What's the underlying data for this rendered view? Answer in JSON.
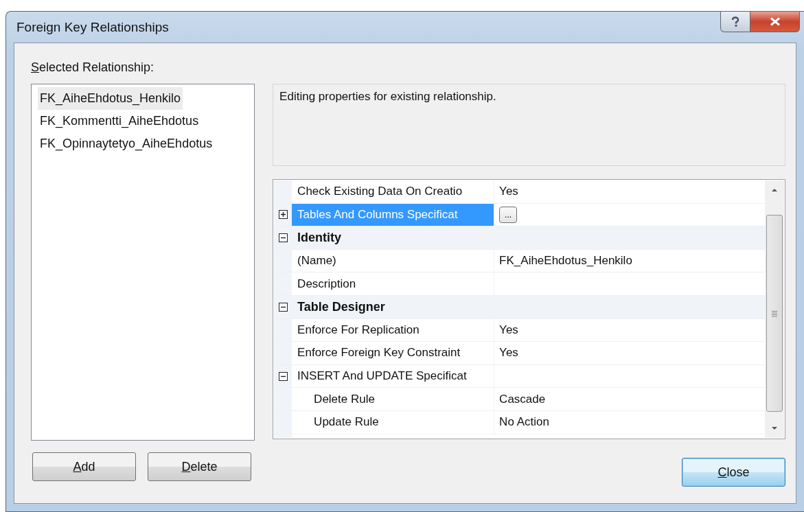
{
  "window": {
    "title": "Foreign Key Relationships"
  },
  "relationships_label": {
    "text": "Selected Relationship:",
    "underline_first": true
  },
  "relationships": [
    {
      "label": "FK_AiheEhdotus_Henkilo",
      "selected": true
    },
    {
      "label": "FK_Kommentti_AiheEhdotus",
      "selected": false
    },
    {
      "label": "FK_Opinnaytetyo_AiheEhdotus",
      "selected": false
    }
  ],
  "description": "Editing properties for existing relationship.",
  "properties": [
    {
      "kind": "property",
      "name": "Check Existing Data On Creatio",
      "value": "Yes",
      "selected": false
    },
    {
      "kind": "property",
      "name": "Tables And Columns Specificat",
      "selected": true,
      "expanded": false,
      "ellipsis_button": "..."
    },
    {
      "kind": "category",
      "name": "Identity",
      "selected": false,
      "expanded": true,
      "children": [
        {
          "kind": "property",
          "name": "(Name)",
          "value": "FK_AiheEhdotus_Henkilo",
          "selected": false
        },
        {
          "kind": "property",
          "name": "Description",
          "selected": false
        }
      ]
    },
    {
      "kind": "category",
      "name": "Table Designer",
      "selected": false,
      "expanded": true,
      "children": [
        {
          "kind": "property",
          "name": "Enforce For Replication",
          "value": "Yes",
          "selected": false
        },
        {
          "kind": "property",
          "name": "Enforce Foreign Key Constraint",
          "value": "Yes",
          "selected": false
        },
        {
          "kind": "property",
          "name": "INSERT And UPDATE Specificat",
          "selected": false,
          "expanded": true,
          "children": [
            {
              "kind": "property",
              "name": "Delete Rule",
              "value": "Cascade",
              "selected": false
            },
            {
              "kind": "property",
              "name": "Update Rule",
              "value": "No Action",
              "selected": false
            }
          ]
        }
      ]
    }
  ],
  "buttons": [
    {
      "label": "Add",
      "underline_first": true,
      "default": false
    },
    {
      "label": "Delete",
      "underline_first": true,
      "default": false
    }
  ],
  "close_button": {
    "label": "Close",
    "underline_first": true,
    "default": true
  }
}
